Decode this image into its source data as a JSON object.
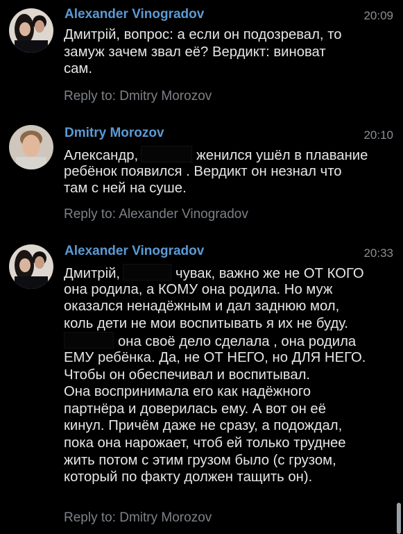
{
  "colors": {
    "background": "#000000",
    "author": "#5b9bd5",
    "text": "#e6e6e6",
    "meta": "#8a8f96",
    "redaction": "#000000"
  },
  "messages": [
    {
      "author": "Alexander Vinogradov",
      "time": "20:09",
      "avatar_icon": "couple-photo-avatar",
      "lines": [
        [
          "Дмитрій, вопрос: а если он подозревал, то"
        ],
        [
          "замуж зачем звал её? Вердикт: виноват"
        ],
        [
          "сам."
        ]
      ],
      "reply_to": "Reply to: Dmitry Morozov"
    },
    {
      "author": "Dmitry Morozov",
      "time": "20:10",
      "avatar_icon": "man-photo-avatar",
      "lines": [
        [
          "Александр,",
          "женился  ушёл в плавание"
        ],
        [
          "ребёнок появился . Вердикт он незнал что"
        ],
        [
          "там с ней на суше."
        ]
      ],
      "reply_to": "Reply to: Alexander Vinogradov"
    },
    {
      "author": "Alexander Vinogradov",
      "time": "20:33",
      "avatar_icon": "couple-photo-avatar",
      "lines": [
        [
          "Дмитрій,",
          "чувак, важно же не ОТ КОГО"
        ],
        [
          "она родила, а КОМУ она родила. Но муж"
        ],
        [
          "оказался ненадёжным и дал заднюю мол,"
        ],
        [
          "коль дети не мои воспитывать я их не буду."
        ],
        [
          "",
          "она своё дело сделала , она родила"
        ],
        [
          "ЕМУ ребёнка. Да, не ОТ НЕГО, но ДЛЯ НЕГО."
        ],
        [
          "Чтобы он обеспечивал и воспитывал."
        ],
        [
          "Она воспринимала его как надёжного"
        ],
        [
          "партнёра и доверилась ему. А вот он её"
        ],
        [
          "кинул. Причём даже не сразу, а подождал,"
        ],
        [
          "пока она нарожает, чтоб ей только труднее"
        ],
        [
          "жить потом с этим грузом было (с грузом,"
        ],
        [
          "который по факту должен тащить он)."
        ]
      ],
      "reply_to": "Reply to: Dmitry Morozov"
    }
  ]
}
